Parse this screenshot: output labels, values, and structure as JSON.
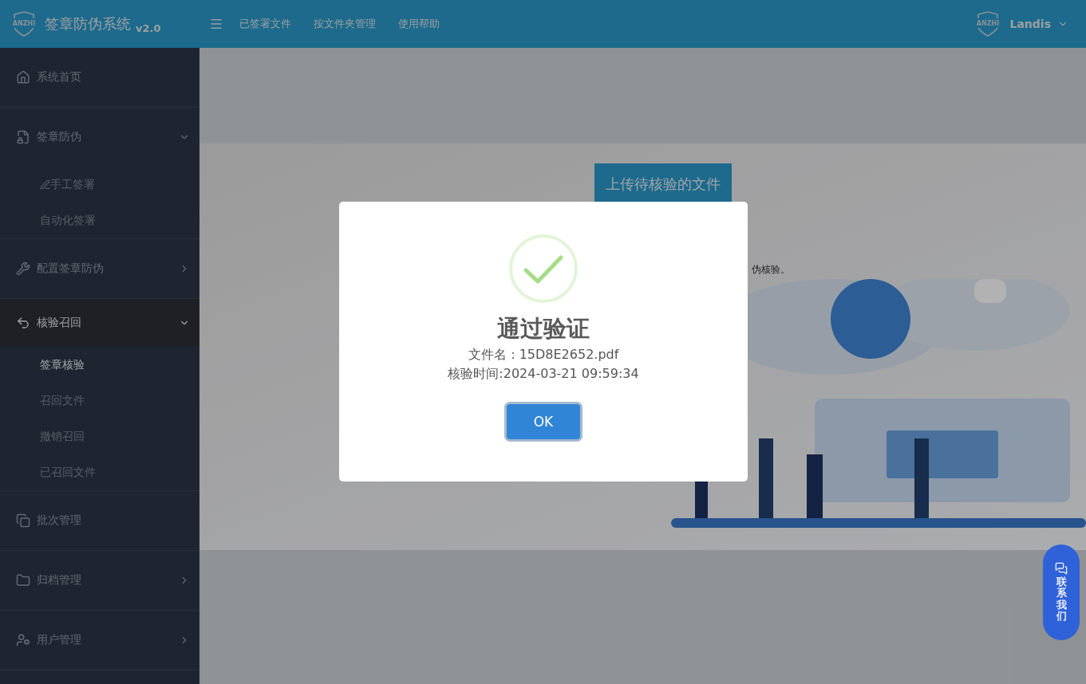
{
  "header": {
    "logo_text": "ANZHI",
    "title": "签章防伪系统",
    "version": "v2.0",
    "nav": [
      "已签署文件",
      "按文件夹管理",
      "使用帮助"
    ],
    "user": {
      "logo_text": "ANZHI",
      "name": "Landis"
    }
  },
  "sidebar": {
    "items": [
      {
        "label": "系统首页",
        "kind": "link",
        "selected": false
      },
      {
        "label": "签章防伪",
        "kind": "group",
        "expanded": true,
        "selected": false,
        "children": [
          {
            "label": "手工签署",
            "selected": false,
            "icon": true
          },
          {
            "label": "自动化签署",
            "selected": false,
            "icon": false
          }
        ]
      },
      {
        "label": "配置签章防伪",
        "kind": "group",
        "expanded": false,
        "selected": false
      },
      {
        "label": "核验召回",
        "kind": "group",
        "expanded": true,
        "selected": true,
        "children": [
          {
            "label": "签章核验",
            "selected": true,
            "icon": false
          },
          {
            "label": "召回文件",
            "selected": false,
            "icon": false
          },
          {
            "label": "撤销召回",
            "selected": false,
            "icon": false
          },
          {
            "label": "已召回文件",
            "selected": false,
            "icon": false
          }
        ]
      },
      {
        "label": "批次管理",
        "kind": "link",
        "selected": false
      },
      {
        "label": "归档管理",
        "kind": "group",
        "expanded": false,
        "selected": false
      },
      {
        "label": "用户管理",
        "kind": "group",
        "expanded": false,
        "selected": false
      }
    ]
  },
  "content": {
    "upload_button": "上传待核验的文件",
    "description_tail": "伪核验。"
  },
  "dialog": {
    "title": "通过验证",
    "lines": [
      "文件名：15D8E2652.pdf",
      "核验时间:2024-03-21 09:59:34"
    ],
    "ok_button": "OK"
  },
  "contact": {
    "label": "联系我们"
  }
}
